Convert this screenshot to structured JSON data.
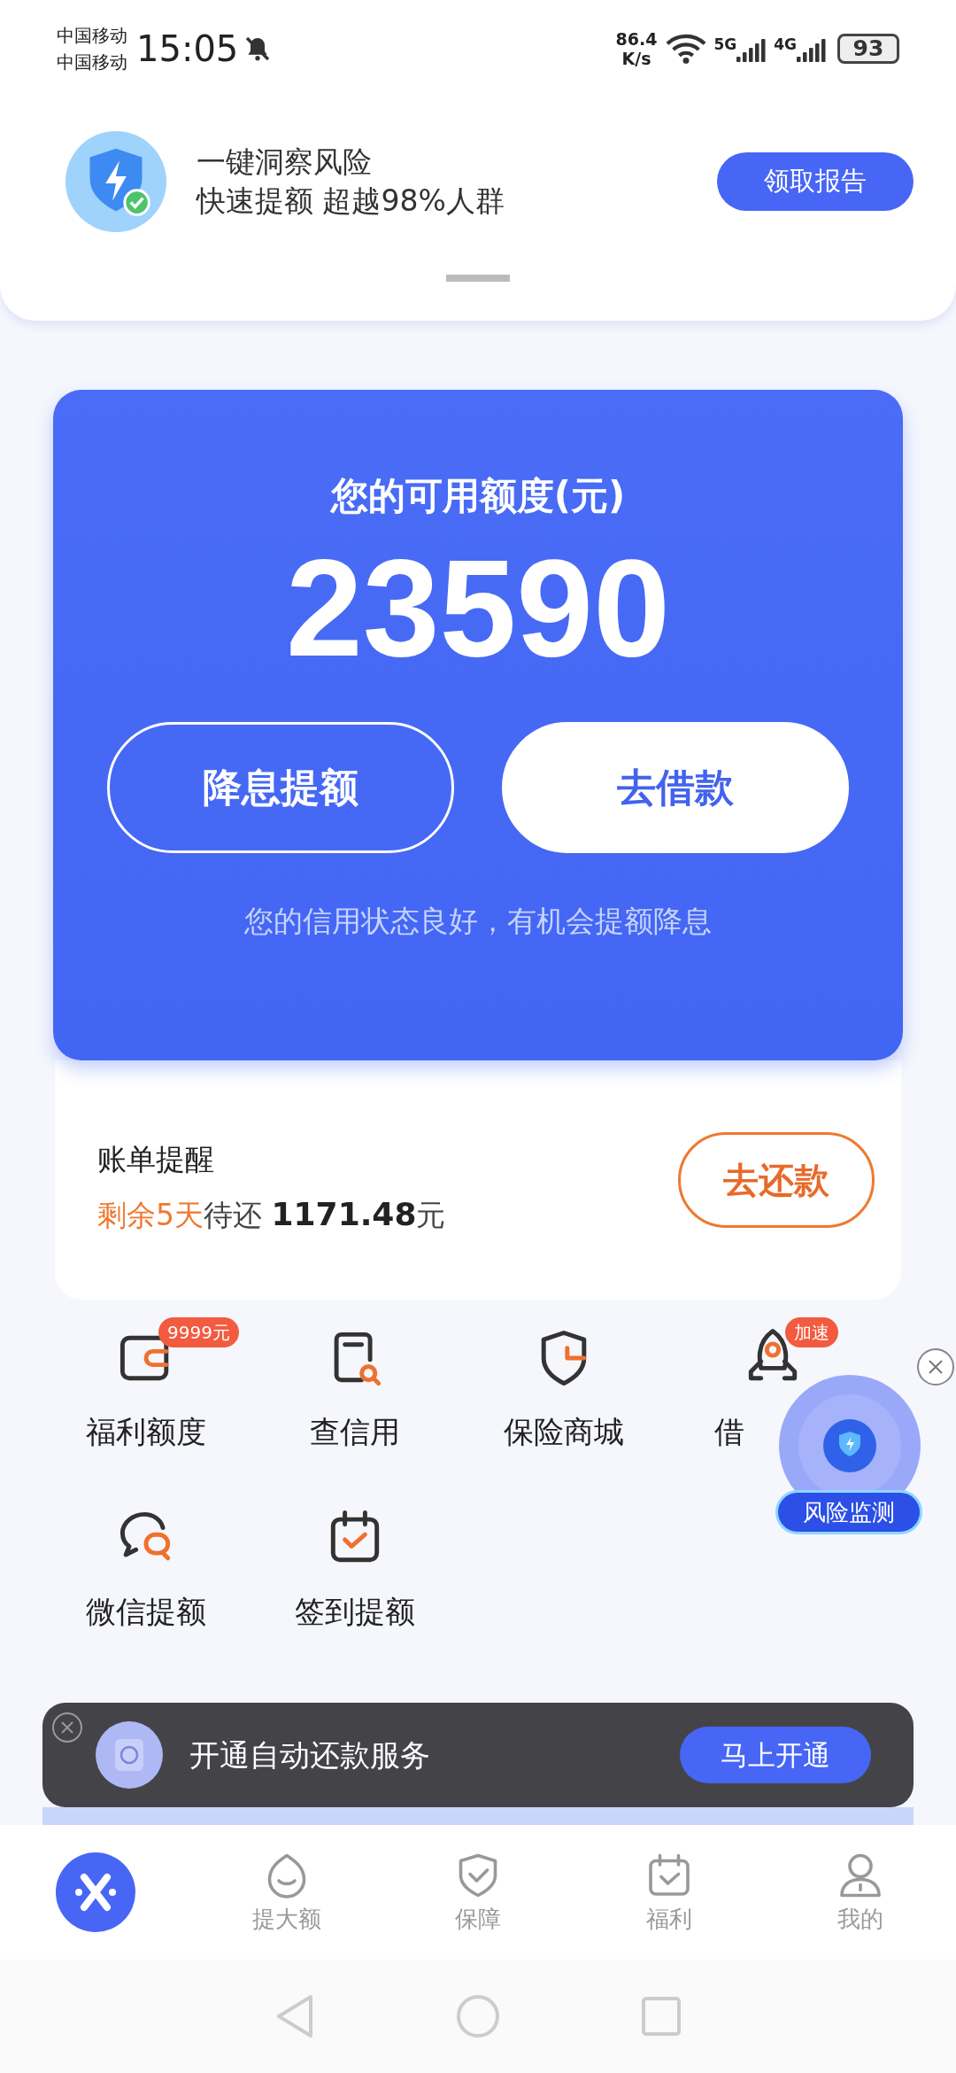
{
  "status_bar": {
    "carriers": [
      "中国移动",
      "中国移动"
    ],
    "time": "15:05",
    "speed_value": "86.4",
    "speed_unit": "K/s",
    "networks": [
      "5G",
      "4G"
    ],
    "battery": "93"
  },
  "promo": {
    "title": "一键洞察风险",
    "subtitle": "快速提额 超越98%人群",
    "button": "领取报告"
  },
  "quota_card": {
    "title": "您的可用额度(元)",
    "amount": "23590",
    "buttons": [
      {
        "label": "降息提额",
        "kind": "outline"
      },
      {
        "label": "去借款",
        "kind": "filled"
      }
    ],
    "note": "您的信用状态良好，有机会提额降息"
  },
  "bill": {
    "title": "账单提醒",
    "days": "剩余5天",
    "due_label": "待还",
    "amount": "1171.48",
    "unit": "元",
    "button": "去还款"
  },
  "services": [
    {
      "label": "福利额度",
      "kind": "wallet",
      "badge": "9999元"
    },
    {
      "label": "查信用",
      "kind": "search"
    },
    {
      "label": "保险商城",
      "kind": "shield"
    },
    {
      "label": "借",
      "kind": "rocket",
      "badge": "加速"
    },
    {
      "label": "微信提额",
      "kind": "chat"
    },
    {
      "label": "签到提额",
      "kind": "calendar"
    }
  ],
  "float_widget": {
    "label": "风险监测"
  },
  "toast": {
    "text": "开通自动还款服务",
    "button": "马上开通"
  },
  "tabs": [
    {
      "kind": "logo",
      "selected": true
    },
    {
      "label": "提大额",
      "kind": "face",
      "selected": false
    },
    {
      "label": "保障",
      "kind": "shield",
      "selected": false
    },
    {
      "label": "福利",
      "kind": "calendar",
      "selected": false
    },
    {
      "label": "我的",
      "kind": "person",
      "selected": false
    }
  ]
}
